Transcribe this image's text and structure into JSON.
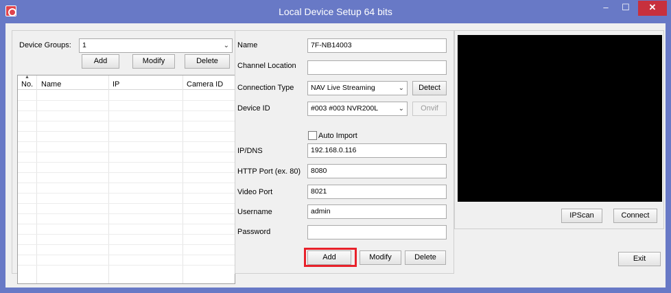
{
  "window": {
    "title": "Local Device Setup 64 bits"
  },
  "groups": {
    "label": "Device Groups:",
    "selected": "1",
    "add": "Add",
    "modify": "Modify",
    "delete": "Delete"
  },
  "table": {
    "columns": [
      "No.",
      "Name",
      "IP",
      "Camera ID"
    ],
    "rows": []
  },
  "form": {
    "name_label": "Name",
    "name_value": "7F-NB14003",
    "channel_label": "Channel Location",
    "channel_value": "",
    "conn_label": "Connection Type",
    "conn_value": "NAV Live Streaming",
    "detect": "Detect",
    "device_label": "Device ID",
    "device_value": "#003 #003 NVR200L",
    "onvif": "Onvif",
    "auto_import": "Auto Import",
    "ip_label": "IP/DNS",
    "ip_value": "192.168.0.116",
    "http_label": "HTTP Port (ex. 80)",
    "http_value": "8080",
    "video_label": "Video Port",
    "video_value": "8021",
    "user_label": "Username",
    "user_value": "admin",
    "pass_label": "Password",
    "pass_value": "",
    "add": "Add",
    "modify": "Modify",
    "delete": "Delete"
  },
  "preview": {
    "ipscan": "IPScan",
    "connect": "Connect",
    "exit": "Exit"
  },
  "colors": {
    "titlebar": "#6879c6",
    "close": "#c7303d",
    "highlight": "#e8212a"
  }
}
